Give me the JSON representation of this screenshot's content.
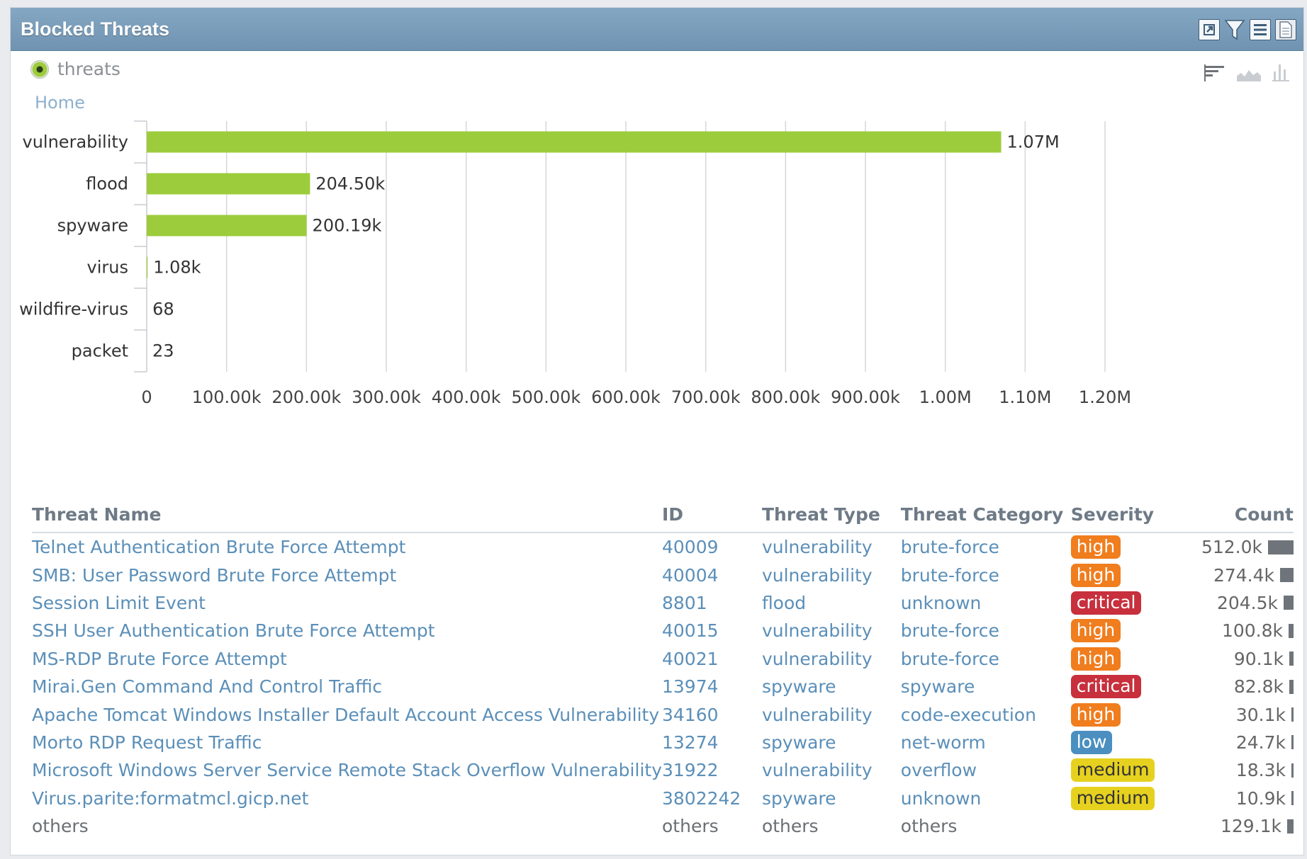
{
  "header": {
    "title": "Blocked Threats",
    "icons": [
      "external-link-icon",
      "filter-icon",
      "list-icon",
      "export-pdf-icon"
    ]
  },
  "legend": {
    "label": "threats",
    "color": "#9ccc3c"
  },
  "breadcrumb": "Home",
  "view_icons": [
    "horizontal-bar-view-icon",
    "area-view-icon",
    "column-view-icon"
  ],
  "chart_data": {
    "type": "bar",
    "orientation": "horizontal",
    "categories": [
      "vulnerability",
      "flood",
      "spyware",
      "virus",
      "wildfire-virus",
      "packet"
    ],
    "values": [
      1070000,
      204500,
      200190,
      1080,
      68,
      23
    ],
    "data_labels": [
      "1.07M",
      "204.50k",
      "200.19k",
      "1.08k",
      "68",
      "23"
    ],
    "xlim": [
      0,
      1200000
    ],
    "xticks": [
      0,
      100000,
      200000,
      300000,
      400000,
      500000,
      600000,
      700000,
      800000,
      900000,
      1000000,
      1100000,
      1200000
    ],
    "xtick_labels": [
      "0",
      "100.00k",
      "200.00k",
      "300.00k",
      "400.00k",
      "500.00k",
      "600.00k",
      "700.00k",
      "800.00k",
      "900.00k",
      "1.00M",
      "1.10M",
      "1.20M"
    ],
    "grid": true,
    "bar_color": "#9ccc3c"
  },
  "table": {
    "columns": [
      "Threat Name",
      "ID",
      "Threat Type",
      "Threat Category",
      "Severity",
      "Count"
    ],
    "rows": [
      {
        "name": "Telnet Authentication Brute Force Attempt",
        "id": "40009",
        "type": "vulnerability",
        "category": "brute-force",
        "severity": "high",
        "count": "512.0k",
        "count_value": 512000
      },
      {
        "name": "SMB: User Password Brute Force Attempt",
        "id": "40004",
        "type": "vulnerability",
        "category": "brute-force",
        "severity": "high",
        "count": "274.4k",
        "count_value": 274400
      },
      {
        "name": "Session Limit Event",
        "id": "8801",
        "type": "flood",
        "category": "unknown",
        "severity": "critical",
        "count": "204.5k",
        "count_value": 204500
      },
      {
        "name": "SSH User Authentication Brute Force Attempt",
        "id": "40015",
        "type": "vulnerability",
        "category": "brute-force",
        "severity": "high",
        "count": "100.8k",
        "count_value": 100800
      },
      {
        "name": "MS-RDP Brute Force Attempt",
        "id": "40021",
        "type": "vulnerability",
        "category": "brute-force",
        "severity": "high",
        "count": "90.1k",
        "count_value": 90100
      },
      {
        "name": "Mirai.Gen Command And Control Traffic",
        "id": "13974",
        "type": "spyware",
        "category": "spyware",
        "severity": "critical",
        "count": "82.8k",
        "count_value": 82800
      },
      {
        "name": "Apache Tomcat Windows Installer Default Account Access Vulnerability",
        "id": "34160",
        "type": "vulnerability",
        "category": "code-execution",
        "severity": "high",
        "count": "30.1k",
        "count_value": 30100
      },
      {
        "name": "Morto RDP Request Traffic",
        "id": "13274",
        "type": "spyware",
        "category": "net-worm",
        "severity": "low",
        "count": "24.7k",
        "count_value": 24700
      },
      {
        "name": "Microsoft Windows Server Service Remote Stack Overflow Vulnerability",
        "id": "31922",
        "type": "vulnerability",
        "category": "overflow",
        "severity": "medium",
        "count": "18.3k",
        "count_value": 18300
      },
      {
        "name": "Virus.parite:formatmcl.gicp.net",
        "id": "3802242",
        "type": "spyware",
        "category": "unknown",
        "severity": "medium",
        "count": "10.9k",
        "count_value": 10900
      },
      {
        "name": "others",
        "id": "others",
        "type": "others",
        "category": "others",
        "severity": "",
        "count": "129.1k",
        "count_value": 129100
      }
    ]
  },
  "severity_colors": {
    "high": "#f07d1e",
    "critical": "#c7303c",
    "low": "#4a8fc0",
    "medium": "#e6d11f"
  }
}
